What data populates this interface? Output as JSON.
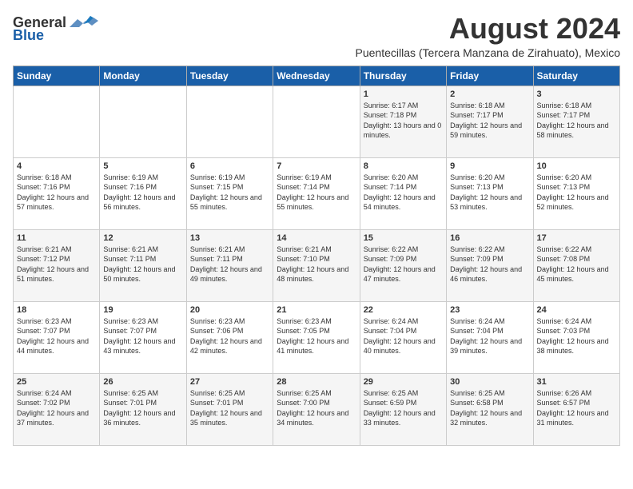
{
  "header": {
    "logo_general": "General",
    "logo_blue": "Blue",
    "title": "August 2024",
    "subtitle": "Puentecillas (Tercera Manzana de Zirahuato), Mexico"
  },
  "weekdays": [
    "Sunday",
    "Monday",
    "Tuesday",
    "Wednesday",
    "Thursday",
    "Friday",
    "Saturday"
  ],
  "weeks": [
    [
      {
        "day": "",
        "sunrise": "",
        "sunset": "",
        "daylight": ""
      },
      {
        "day": "",
        "sunrise": "",
        "sunset": "",
        "daylight": ""
      },
      {
        "day": "",
        "sunrise": "",
        "sunset": "",
        "daylight": ""
      },
      {
        "day": "",
        "sunrise": "",
        "sunset": "",
        "daylight": ""
      },
      {
        "day": "1",
        "sunrise": "Sunrise: 6:17 AM",
        "sunset": "Sunset: 7:18 PM",
        "daylight": "Daylight: 13 hours and 0 minutes."
      },
      {
        "day": "2",
        "sunrise": "Sunrise: 6:18 AM",
        "sunset": "Sunset: 7:17 PM",
        "daylight": "Daylight: 12 hours and 59 minutes."
      },
      {
        "day": "3",
        "sunrise": "Sunrise: 6:18 AM",
        "sunset": "Sunset: 7:17 PM",
        "daylight": "Daylight: 12 hours and 58 minutes."
      }
    ],
    [
      {
        "day": "4",
        "sunrise": "Sunrise: 6:18 AM",
        "sunset": "Sunset: 7:16 PM",
        "daylight": "Daylight: 12 hours and 57 minutes."
      },
      {
        "day": "5",
        "sunrise": "Sunrise: 6:19 AM",
        "sunset": "Sunset: 7:16 PM",
        "daylight": "Daylight: 12 hours and 56 minutes."
      },
      {
        "day": "6",
        "sunrise": "Sunrise: 6:19 AM",
        "sunset": "Sunset: 7:15 PM",
        "daylight": "Daylight: 12 hours and 55 minutes."
      },
      {
        "day": "7",
        "sunrise": "Sunrise: 6:19 AM",
        "sunset": "Sunset: 7:14 PM",
        "daylight": "Daylight: 12 hours and 55 minutes."
      },
      {
        "day": "8",
        "sunrise": "Sunrise: 6:20 AM",
        "sunset": "Sunset: 7:14 PM",
        "daylight": "Daylight: 12 hours and 54 minutes."
      },
      {
        "day": "9",
        "sunrise": "Sunrise: 6:20 AM",
        "sunset": "Sunset: 7:13 PM",
        "daylight": "Daylight: 12 hours and 53 minutes."
      },
      {
        "day": "10",
        "sunrise": "Sunrise: 6:20 AM",
        "sunset": "Sunset: 7:13 PM",
        "daylight": "Daylight: 12 hours and 52 minutes."
      }
    ],
    [
      {
        "day": "11",
        "sunrise": "Sunrise: 6:21 AM",
        "sunset": "Sunset: 7:12 PM",
        "daylight": "Daylight: 12 hours and 51 minutes."
      },
      {
        "day": "12",
        "sunrise": "Sunrise: 6:21 AM",
        "sunset": "Sunset: 7:11 PM",
        "daylight": "Daylight: 12 hours and 50 minutes."
      },
      {
        "day": "13",
        "sunrise": "Sunrise: 6:21 AM",
        "sunset": "Sunset: 7:11 PM",
        "daylight": "Daylight: 12 hours and 49 minutes."
      },
      {
        "day": "14",
        "sunrise": "Sunrise: 6:21 AM",
        "sunset": "Sunset: 7:10 PM",
        "daylight": "Daylight: 12 hours and 48 minutes."
      },
      {
        "day": "15",
        "sunrise": "Sunrise: 6:22 AM",
        "sunset": "Sunset: 7:09 PM",
        "daylight": "Daylight: 12 hours and 47 minutes."
      },
      {
        "day": "16",
        "sunrise": "Sunrise: 6:22 AM",
        "sunset": "Sunset: 7:09 PM",
        "daylight": "Daylight: 12 hours and 46 minutes."
      },
      {
        "day": "17",
        "sunrise": "Sunrise: 6:22 AM",
        "sunset": "Sunset: 7:08 PM",
        "daylight": "Daylight: 12 hours and 45 minutes."
      }
    ],
    [
      {
        "day": "18",
        "sunrise": "Sunrise: 6:23 AM",
        "sunset": "Sunset: 7:07 PM",
        "daylight": "Daylight: 12 hours and 44 minutes."
      },
      {
        "day": "19",
        "sunrise": "Sunrise: 6:23 AM",
        "sunset": "Sunset: 7:07 PM",
        "daylight": "Daylight: 12 hours and 43 minutes."
      },
      {
        "day": "20",
        "sunrise": "Sunrise: 6:23 AM",
        "sunset": "Sunset: 7:06 PM",
        "daylight": "Daylight: 12 hours and 42 minutes."
      },
      {
        "day": "21",
        "sunrise": "Sunrise: 6:23 AM",
        "sunset": "Sunset: 7:05 PM",
        "daylight": "Daylight: 12 hours and 41 minutes."
      },
      {
        "day": "22",
        "sunrise": "Sunrise: 6:24 AM",
        "sunset": "Sunset: 7:04 PM",
        "daylight": "Daylight: 12 hours and 40 minutes."
      },
      {
        "day": "23",
        "sunrise": "Sunrise: 6:24 AM",
        "sunset": "Sunset: 7:04 PM",
        "daylight": "Daylight: 12 hours and 39 minutes."
      },
      {
        "day": "24",
        "sunrise": "Sunrise: 6:24 AM",
        "sunset": "Sunset: 7:03 PM",
        "daylight": "Daylight: 12 hours and 38 minutes."
      }
    ],
    [
      {
        "day": "25",
        "sunrise": "Sunrise: 6:24 AM",
        "sunset": "Sunset: 7:02 PM",
        "daylight": "Daylight: 12 hours and 37 minutes."
      },
      {
        "day": "26",
        "sunrise": "Sunrise: 6:25 AM",
        "sunset": "Sunset: 7:01 PM",
        "daylight": "Daylight: 12 hours and 36 minutes."
      },
      {
        "day": "27",
        "sunrise": "Sunrise: 6:25 AM",
        "sunset": "Sunset: 7:01 PM",
        "daylight": "Daylight: 12 hours and 35 minutes."
      },
      {
        "day": "28",
        "sunrise": "Sunrise: 6:25 AM",
        "sunset": "Sunset: 7:00 PM",
        "daylight": "Daylight: 12 hours and 34 minutes."
      },
      {
        "day": "29",
        "sunrise": "Sunrise: 6:25 AM",
        "sunset": "Sunset: 6:59 PM",
        "daylight": "Daylight: 12 hours and 33 minutes."
      },
      {
        "day": "30",
        "sunrise": "Sunrise: 6:25 AM",
        "sunset": "Sunset: 6:58 PM",
        "daylight": "Daylight: 12 hours and 32 minutes."
      },
      {
        "day": "31",
        "sunrise": "Sunrise: 6:26 AM",
        "sunset": "Sunset: 6:57 PM",
        "daylight": "Daylight: 12 hours and 31 minutes."
      }
    ]
  ]
}
